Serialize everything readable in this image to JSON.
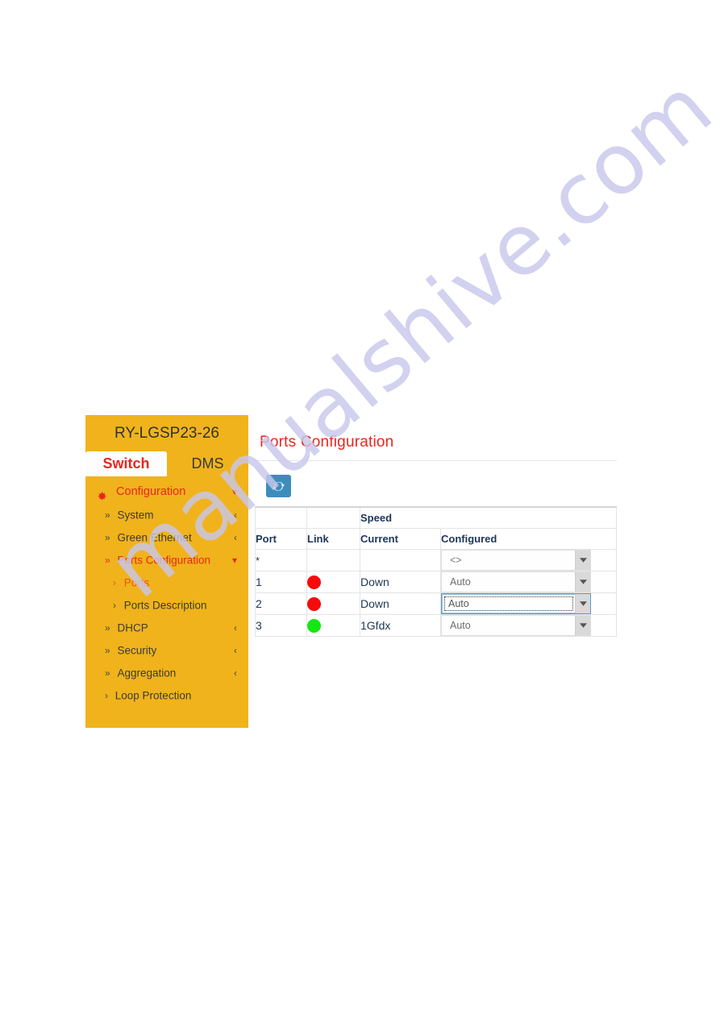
{
  "watermark": {
    "text": "manualshive.com"
  },
  "sidebar": {
    "device_title": "RY-LGSP23-26",
    "tabs": [
      {
        "label": "Switch",
        "active": true
      },
      {
        "label": "DMS",
        "active": false
      }
    ],
    "items": [
      {
        "label": "Configuration",
        "icon": "gear-icon",
        "chevron": "chevron-down-icon",
        "level": 0,
        "selected": true
      },
      {
        "label": "System",
        "bullet": "double-angle-right-icon",
        "chevron": "chevron-left-icon",
        "level": 1,
        "selected": false
      },
      {
        "label": "Green Ethernet",
        "bullet": "double-angle-right-icon",
        "chevron": "chevron-left-icon",
        "level": 1,
        "selected": false
      },
      {
        "label": "Ports Configuration",
        "bullet": "double-angle-right-icon",
        "chevron": "chevron-down-icon",
        "level": 1,
        "selected": true
      },
      {
        "label": "Ports",
        "bullet": "angle-right-icon",
        "chevron": "",
        "level": 2,
        "selected": true
      },
      {
        "label": "Ports Description",
        "bullet": "angle-right-icon",
        "chevron": "",
        "level": 2,
        "selected": false
      },
      {
        "label": "DHCP",
        "bullet": "double-angle-right-icon",
        "chevron": "chevron-left-icon",
        "level": 1,
        "selected": false
      },
      {
        "label": "Security",
        "bullet": "double-angle-right-icon",
        "chevron": "chevron-left-icon",
        "level": 1,
        "selected": false
      },
      {
        "label": "Aggregation",
        "bullet": "double-angle-right-icon",
        "chevron": "chevron-left-icon",
        "level": 1,
        "selected": false
      },
      {
        "label": "Loop Protection",
        "bullet": "angle-right-icon",
        "chevron": "",
        "level": 1,
        "selected": false
      }
    ]
  },
  "content": {
    "page_title": "Ports Configuration",
    "refresh_button": {
      "icon": "refresh-icon",
      "label": ""
    },
    "table": {
      "group_header": "Speed",
      "headers": {
        "port": "Port",
        "link": "Link",
        "current": "Current",
        "configured": "Configured"
      },
      "rows": [
        {
          "port": "*",
          "link": "",
          "current": "",
          "configured": "<>",
          "focused": false
        },
        {
          "port": "1",
          "link": "red",
          "current": "Down",
          "configured": "Auto",
          "focused": false
        },
        {
          "port": "2",
          "link": "red",
          "current": "Down",
          "configured": "Auto",
          "focused": true
        },
        {
          "port": "3",
          "link": "green",
          "current": "1Gfdx",
          "configured": "Auto",
          "focused": false
        }
      ]
    }
  },
  "colors": {
    "sidebar_bg": "#f0b31c",
    "accent_red": "#e8261c",
    "refresh_blue": "#3c8dbc",
    "header_text": "#1d3557",
    "led_red": "#f50b0b",
    "led_green": "#14e814",
    "watermark": "#c9c7ec"
  }
}
